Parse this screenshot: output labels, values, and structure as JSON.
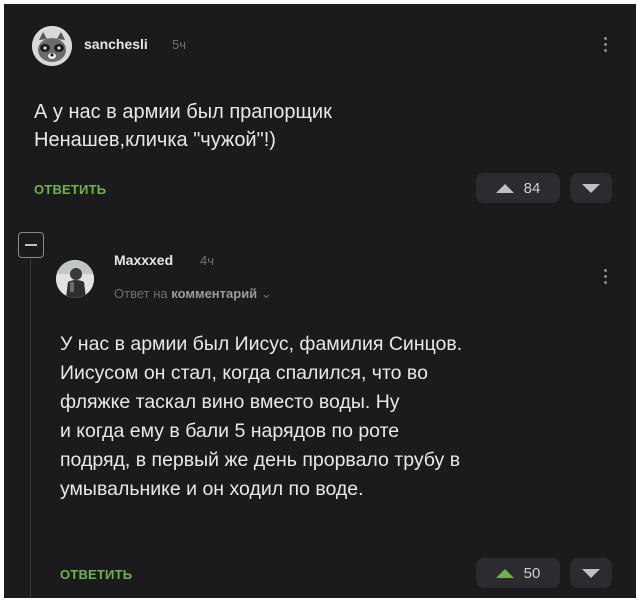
{
  "comment": {
    "username": "sanchesli",
    "time": "5ч",
    "text": "А у нас в армии был прапорщик\nНенашев,кличка \"чужой\"!)",
    "reply_label": "ОТВЕТИТЬ",
    "votes": "84"
  },
  "reply": {
    "username": "Maxxxed",
    "time": "4ч",
    "reply_to_prefix": "Ответ на",
    "reply_to_target": "комментарий",
    "reply_to_chevron": "⌄",
    "text": "У нас в армии был Иисус, фамилия Синцов.\nИисусом он стал, когда спалился, что во\nфляжке таскал вино вместо воды. Ну\nи когда ему в бали 5 нарядов по роте\nподряд, в первый же день прорвало трубу в\nумывальнике и он ходил по воде.",
    "reply_label": "ОТВЕТИТЬ",
    "votes": "50"
  }
}
